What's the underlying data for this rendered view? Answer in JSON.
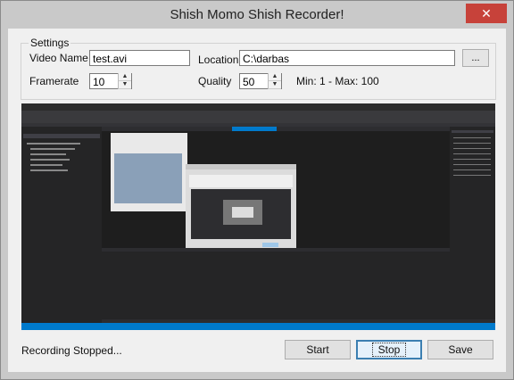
{
  "window": {
    "title": "Shish Momo Shish Recorder!",
    "close_glyph": "✕"
  },
  "settings": {
    "group_label": "Settings",
    "video_name_label": "Video Name",
    "video_name_value": "test.avi",
    "location_label": "Location",
    "location_value": "C:\\darbas",
    "browse_label": "...",
    "framerate_label": "Framerate",
    "framerate_value": "10",
    "quality_label": "Quality",
    "quality_value": "50",
    "quality_range_text": "Min: 1 - Max: 100"
  },
  "status": {
    "text": "Recording Stopped..."
  },
  "buttons": {
    "start": "Start",
    "stop": "Stop",
    "save": "Save"
  },
  "colors": {
    "accent": "#3c7fb1",
    "close": "#c7423a",
    "preview_bg": "#2d2d30"
  }
}
